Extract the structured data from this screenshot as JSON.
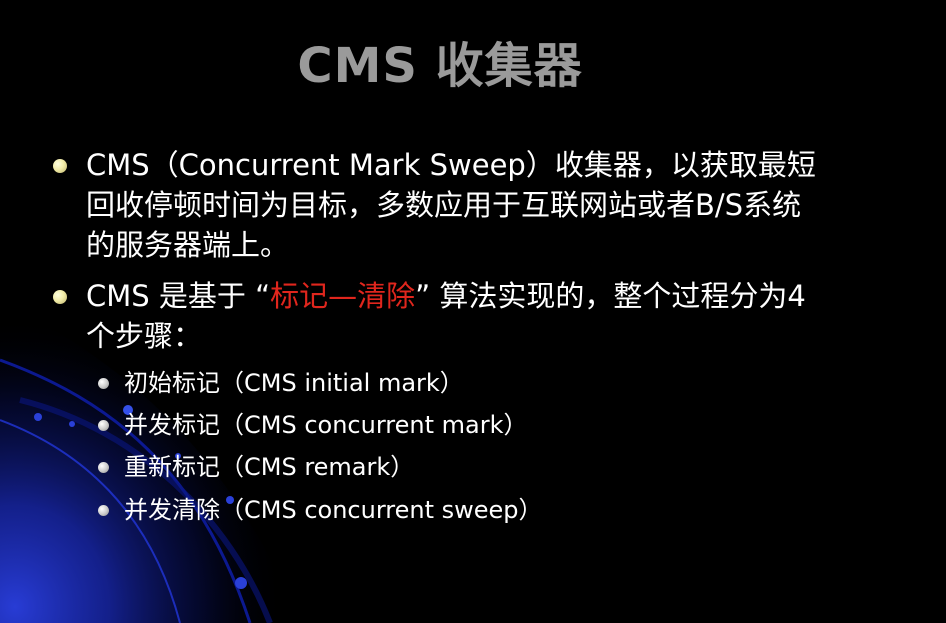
{
  "slide": {
    "title": "CMS 收集器",
    "bullets": [
      {
        "text": "CMS（Concurrent Mark Sweep）收集器，以获取最短回收停顿时间为目标，多数应用于互联网站或者B/S系统的服务器端上。"
      },
      {
        "prefix": "CMS 是基于 “",
        "highlight": "标记—清除",
        "suffix": "” 算法实现的，整个过程分为4个步骤："
      }
    ],
    "steps": [
      "初始标记（CMS initial mark）",
      "并发标记（CMS concurrent mark）",
      "重新标记（CMS remark）",
      "并发清除（CMS concurrent sweep）"
    ]
  },
  "colors": {
    "background": "#000000",
    "title": "#9a9a9a",
    "body_text": "#ffffff",
    "highlight": "#e0261d",
    "decoration": "#1a2fbf"
  }
}
